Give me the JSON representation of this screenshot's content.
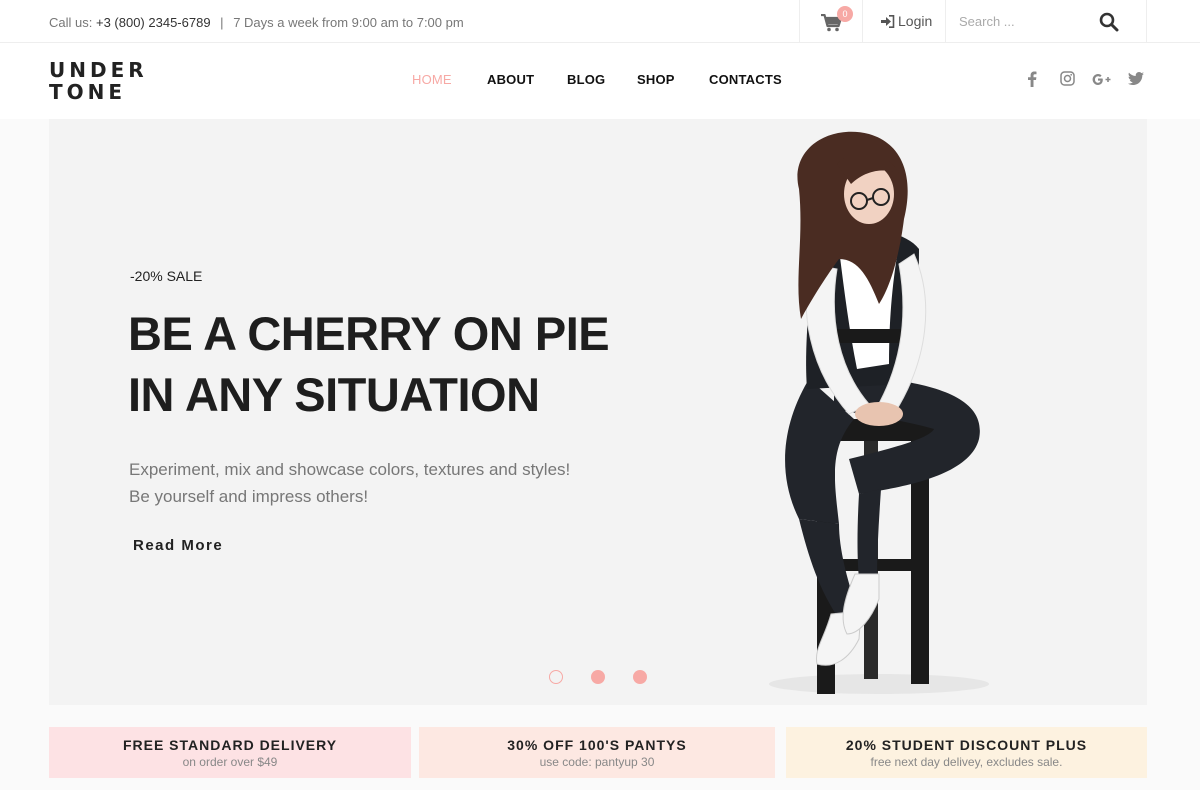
{
  "topbar": {
    "call_label": "Call us:",
    "phone": "+3 (800) 2345-6789",
    "separator": "|",
    "hours": "7 Days a week from 9:00 am to 7:00 pm",
    "cart_count": "0",
    "cart_icon": "cart-icon",
    "login_icon": "sign-in-icon",
    "login_label": "Login",
    "search_placeholder": "Search ...",
    "search_icon": "search-icon"
  },
  "header": {
    "logo_line1": "UNDER",
    "logo_line2": "TONE",
    "nav": [
      {
        "label": "HOME",
        "active": true
      },
      {
        "label": "ABOUT",
        "active": false
      },
      {
        "label": "BLOG",
        "active": false
      },
      {
        "label": "SHOP",
        "active": false
      },
      {
        "label": "CONTACTS",
        "active": false
      }
    ],
    "social": [
      "facebook-icon",
      "instagram-icon",
      "google-plus-icon",
      "twitter-icon"
    ]
  },
  "hero": {
    "sale_label": "-20% SALE",
    "headline_line1": "BE A CHERRY ON PIE",
    "headline_line2": "IN ANY SITUATION",
    "desc_line1": "Experiment, mix and showcase colors, textures and styles!",
    "desc_line2": "Be yourself and impress others!",
    "cta": "Read More",
    "slides": 3,
    "active_slide": 1
  },
  "promos": [
    {
      "title": "FREE STANDARD DELIVERY",
      "subtitle": "on order over $49"
    },
    {
      "title": "30% OFF 100'S PANTYS",
      "subtitle": "use code: pantyup 30"
    },
    {
      "title": "20% STUDENT DISCOUNT PLUS",
      "subtitle": "free next day delivey, excludes sale."
    }
  ],
  "colors": {
    "accent": "#f7a9a5",
    "promo1_bg": "#fde2e4",
    "promo2_bg": "#fde8e2",
    "promo3_bg": "#fdf2e0",
    "hero_bg": "#f3f3f3"
  }
}
